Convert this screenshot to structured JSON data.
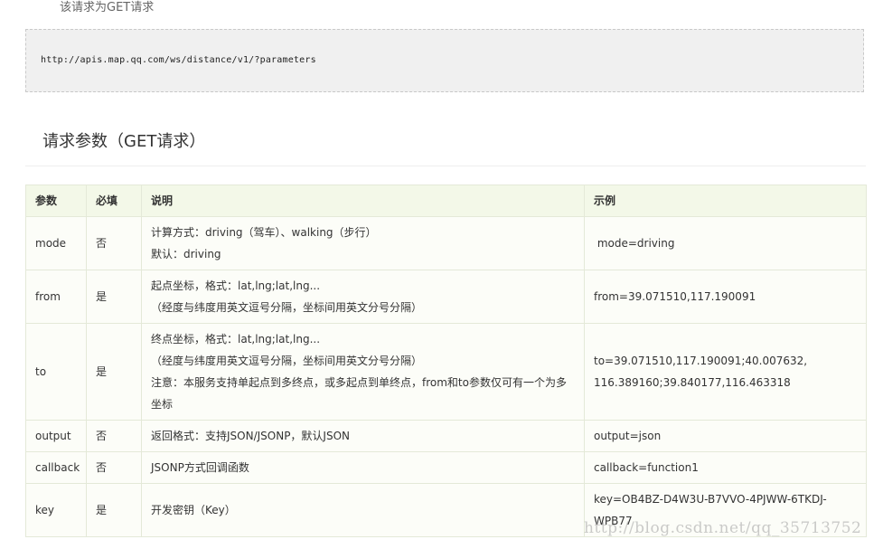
{
  "intro": {
    "text": "该请求为GET请求"
  },
  "code": {
    "url": "http://apis.map.qq.com/ws/distance/v1/?parameters"
  },
  "section": {
    "title": "请求参数（GET请求）"
  },
  "table": {
    "headers": [
      "参数",
      "必填",
      "说明",
      "示例"
    ],
    "rows": [
      {
        "param": "mode",
        "required": "否",
        "desc": [
          "计算方式：driving（驾车）、walking（步行）",
          "默认：driving"
        ],
        "example": [
          " mode=driving"
        ]
      },
      {
        "param": "from",
        "required": "是",
        "desc": [
          "起点坐标，格式：lat,lng;lat,lng...",
          "（经度与纬度用英文逗号分隔，坐标间用英文分号分隔）"
        ],
        "example": [
          "from=39.071510,117.190091"
        ]
      },
      {
        "param": "to",
        "required": "是",
        "desc": [
          "终点坐标，格式：lat,lng;lat,lng...",
          "（经度与纬度用英文逗号分隔，坐标间用英文分号分隔）",
          "注意：本服务支持单起点到多终点，或多起点到单终点，from和to参数仅可有一个为多",
          "坐标"
        ],
        "example": [
          "to=39.071510,117.190091;40.007632,",
          "116.389160;39.840177,116.463318"
        ]
      },
      {
        "param": "output",
        "required": "否",
        "desc": [
          "返回格式：支持JSON/JSONP，默认JSON"
        ],
        "example": [
          "output=json"
        ]
      },
      {
        "param": "callback",
        "required": "否",
        "desc": [
          "JSONP方式回调函数"
        ],
        "example": [
          "callback=function1"
        ]
      },
      {
        "param": "key",
        "required": "是",
        "desc": [
          "开发密钥（Key）"
        ],
        "example": [
          "key=OB4BZ-D4W3U-B7VVO-4PJWW-6TKDJ-",
          "WPB77"
        ]
      }
    ]
  },
  "watermark": {
    "text": "http://blog.csdn.net/qq_35713752"
  }
}
